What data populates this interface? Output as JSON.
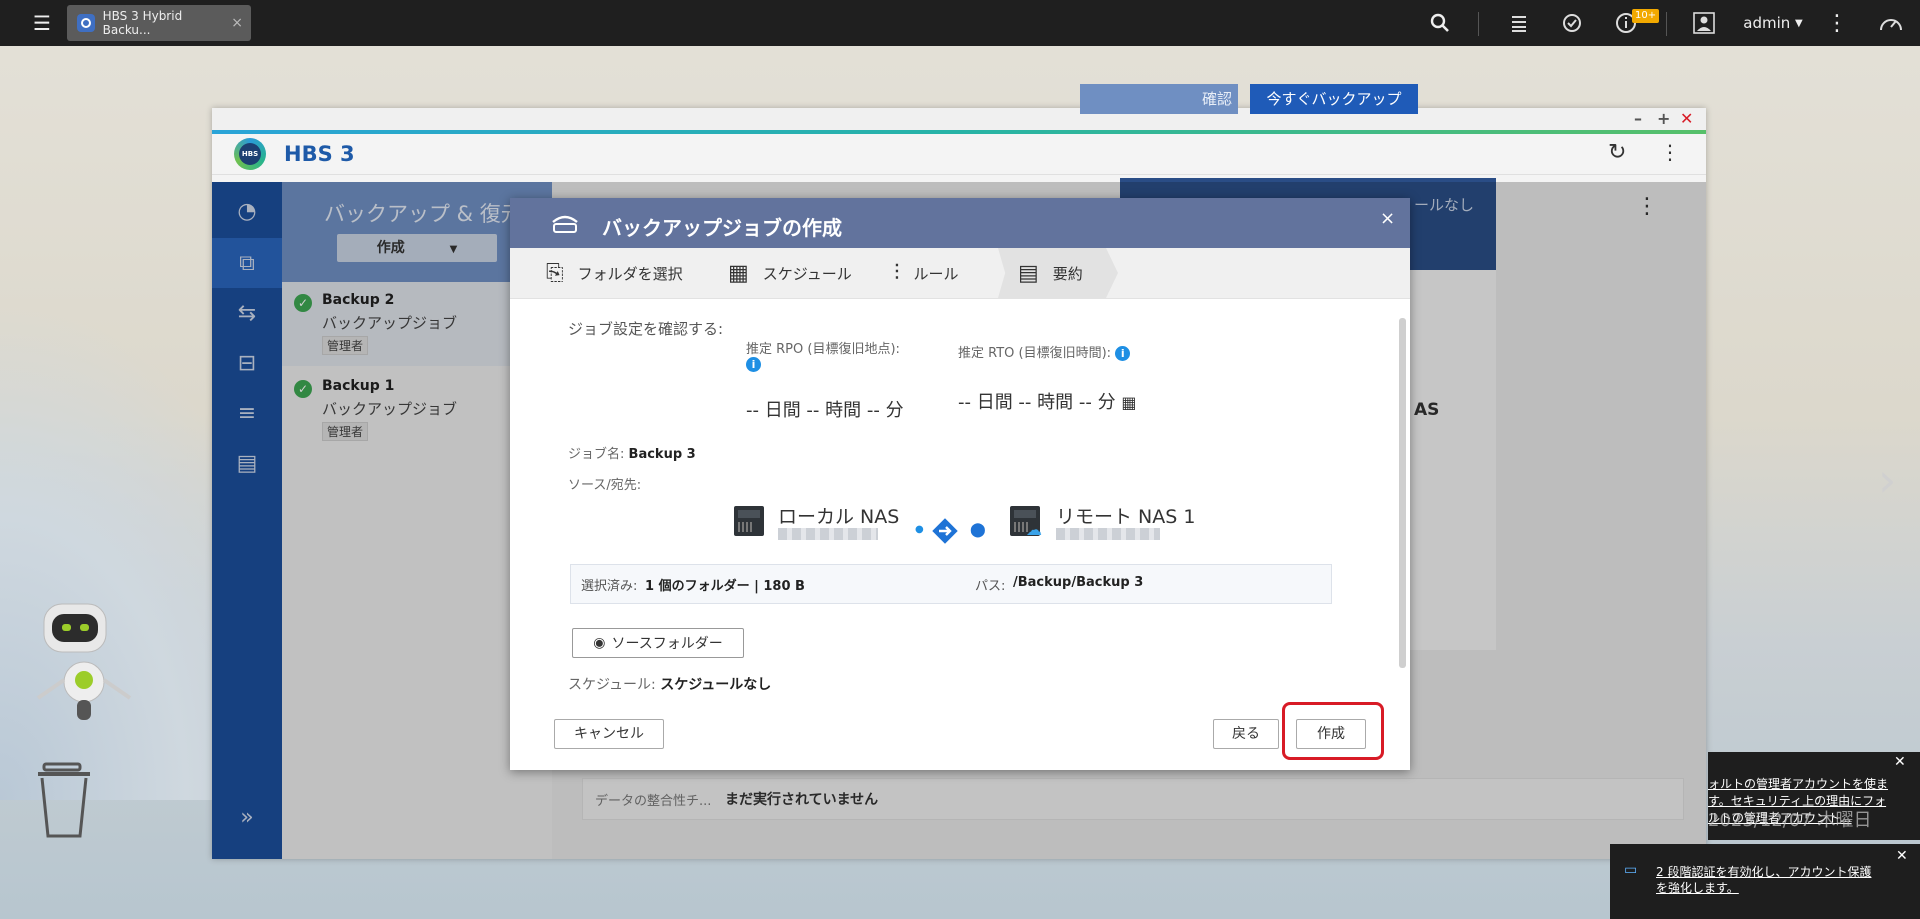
{
  "topbar": {
    "tab_title": "HBS 3 Hybrid Backu...",
    "tab_close": "×",
    "user": "admin",
    "notif_badge": "10+"
  },
  "window": {
    "app_title": "HBS 3",
    "logo_text": "HBS"
  },
  "midpane": {
    "title": "バックアップ & 復元",
    "create_button": "作成",
    "jobs": [
      {
        "name": "Backup 2",
        "type": "バックアップジョブ",
        "role": "管理者"
      },
      {
        "name": "Backup 1",
        "type": "バックアップジョブ",
        "role": "管理者"
      }
    ]
  },
  "main": {
    "confirm_btn": "確認",
    "backup_now_btn": "今すぐバックアップ",
    "band_text": "ールなし",
    "card_text": "AS",
    "integrity_label": "データの整合性チ...",
    "integrity_value": "まだ実行されていません"
  },
  "dialog": {
    "title": "バックアップジョブの作成",
    "close": "×",
    "steps": [
      "フォルダを選択",
      "スケジュール",
      "ルール",
      "要約"
    ],
    "confirm_heading": "ジョブ設定を確認する:",
    "rpo_label": "推定 RPO (目標復旧地点):",
    "rto_label": "推定 RTO (目標復旧時間):",
    "rpo_value": "-- 日間 -- 時間 -- 分",
    "rto_value": "-- 日間 -- 時間 -- 分",
    "job_name_label": "ジョブ名:",
    "job_name": "Backup 3",
    "src_dst_label": "ソース/宛先:",
    "source_name": "ローカル NAS",
    "dest_name": "リモート NAS 1",
    "selected_label": "選択済み:",
    "selected_value": "1 個のフォルダー | 180 B",
    "path_label": "パス:",
    "path_value": "/Backup/Backup 3",
    "source_folder_btn": "ソースフォルダー",
    "schedule_label": "スケジュール:",
    "schedule_value": "スケジュールなし",
    "cancel_btn": "キャンセル",
    "back_btn": "戻る",
    "create_btn": "作成"
  },
  "notifications": {
    "n1": "ォルトの管理者アカウントを使ます。セキュリティ上の理由にフォルトの管理者アカウント...",
    "clock_date": "2023/12/07 木曜日",
    "n2": "2 段階認証を有効化し、アカウント保護を強化します。"
  },
  "colors": {
    "accent": "#1f5bb8",
    "dialog_header": "#62739d",
    "highlight": "#d81b26"
  }
}
